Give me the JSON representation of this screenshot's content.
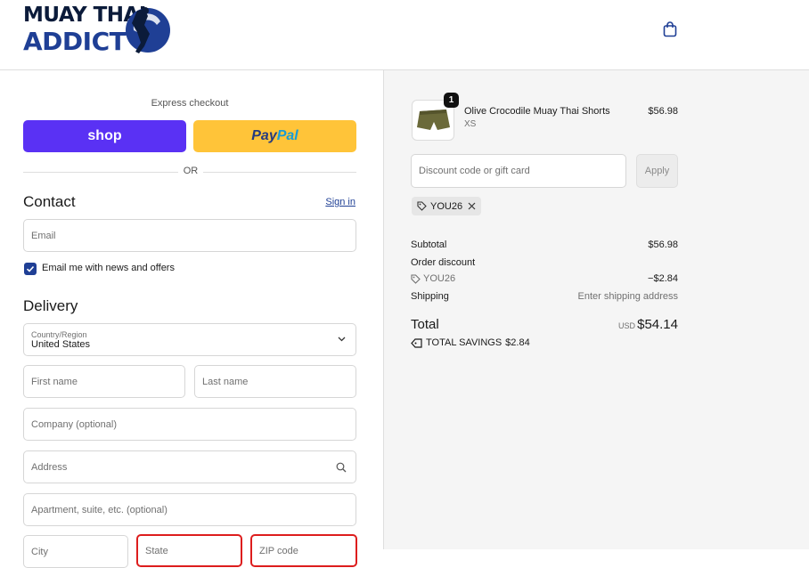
{
  "brand": {
    "logo_line1": "MUAY THAI",
    "logo_line2": "ADDICT"
  },
  "header": {
    "cart_icon": "shopping-bag-icon"
  },
  "checkout": {
    "express_label": "Express checkout",
    "shop_label": "shop",
    "paypal_label_a": "Pay",
    "paypal_label_b": "Pal",
    "or_label": "OR",
    "contact_title": "Contact",
    "signin_label": "Sign in",
    "email_placeholder": "Email",
    "newsletter_label": "Email me with news and offers",
    "newsletter_checked": true,
    "delivery_title": "Delivery",
    "country_label": "Country/Region",
    "country_value": "United States",
    "first_name_placeholder": "First name",
    "last_name_placeholder": "Last name",
    "company_placeholder": "Company (optional)",
    "address_placeholder": "Address",
    "apartment_placeholder": "Apartment, suite, etc. (optional)",
    "city_placeholder": "City",
    "state_placeholder": "State",
    "zip_placeholder": "ZIP code"
  },
  "summary": {
    "item": {
      "quantity": "1",
      "name": "Olive Crocodile Muay Thai Shorts",
      "variant": "XS",
      "price": "$56.98"
    },
    "discount_placeholder": "Discount code or gift card",
    "apply_label": "Apply",
    "applied_code": "YOU26",
    "subtotal_label": "Subtotal",
    "subtotal_value": "$56.98",
    "order_discount_label": "Order discount",
    "discount_code": "YOU26",
    "discount_value": "−$2.84",
    "shipping_label": "Shipping",
    "shipping_value": "Enter shipping address",
    "total_label": "Total",
    "total_currency": "USD",
    "total_value": "$54.14",
    "savings_label": "TOTAL SAVINGS",
    "savings_value": "$2.84"
  },
  "colors": {
    "accent": "#1f3f95",
    "shop_purple": "#5a31f4",
    "paypal_yellow": "#ffc439",
    "error_red": "#dd1d1d"
  }
}
